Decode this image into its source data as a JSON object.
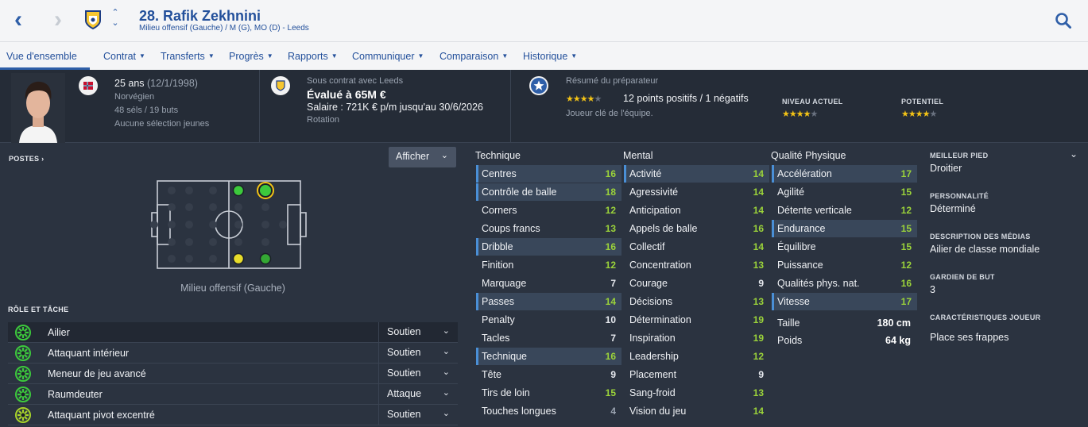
{
  "header": {
    "title": "28. Rafik Zekhnini",
    "subtitle": "Milieu offensif (Gauche) / M (G), MO (D) - Leeds"
  },
  "tabs": [
    {
      "label": "Vue d'ensemble",
      "active": true
    },
    {
      "label": "Contrat"
    },
    {
      "label": "Transferts"
    },
    {
      "label": "Progrès"
    },
    {
      "label": "Rapports"
    },
    {
      "label": "Communiquer"
    },
    {
      "label": "Comparaison"
    },
    {
      "label": "Historique"
    }
  ],
  "player": {
    "age": "25 ans",
    "birth": "(12/1/1998)",
    "nationality": "Norvégien",
    "caps": "48 séls / 19 buts",
    "youth": "Aucune sélection jeunes"
  },
  "contract": {
    "club": "Sous contrat avec Leeds",
    "value": "Évalué à 65M €",
    "salary": "Salaire : 721K € p/m jusqu'au 30/6/2026",
    "status": "Rotation"
  },
  "coach": {
    "title": "Résumé du préparateur",
    "stars": 4,
    "summary": "12 points positifs / 1 négatifs",
    "note": "Joueur clé de l'équipe.",
    "current_label": "NIVEAU ACTUEL",
    "current_stars": 4,
    "potential_label": "POTENTIEL",
    "potential_stars": 4
  },
  "positions": {
    "heading": "POSTES",
    "show_button": "Afficher",
    "label": "Milieu offensif (Gauche)"
  },
  "roles": {
    "heading": "RÔLE ET TÂCHE",
    "items": [
      {
        "name": "Ailier",
        "duty": "Soutien",
        "color": "#3cc93c"
      },
      {
        "name": "Attaquant intérieur",
        "duty": "Soutien",
        "color": "#3cc93c"
      },
      {
        "name": "Meneur de jeu avancé",
        "duty": "Soutien",
        "color": "#3cc93c"
      },
      {
        "name": "Raumdeuter",
        "duty": "Attaque",
        "color": "#3cc93c"
      },
      {
        "name": "Attaquant pivot excentré",
        "duty": "Soutien",
        "color": "#a8d42a"
      }
    ]
  },
  "attributes": {
    "technique": {
      "title": "Technique",
      "items": [
        {
          "name": "Centres",
          "value": "16",
          "hl": true
        },
        {
          "name": "Contrôle de balle",
          "value": "18",
          "hl": true
        },
        {
          "name": "Corners",
          "value": "12"
        },
        {
          "name": "Coups francs",
          "value": "13"
        },
        {
          "name": "Dribble",
          "value": "16",
          "hl": true
        },
        {
          "name": "Finition",
          "value": "12"
        },
        {
          "name": "Marquage",
          "value": "7"
        },
        {
          "name": "Passes",
          "value": "14",
          "hl": true
        },
        {
          "name": "Penalty",
          "value": "10"
        },
        {
          "name": "Tacles",
          "value": "7"
        },
        {
          "name": "Technique",
          "value": "16",
          "hl": true
        },
        {
          "name": "Tête",
          "value": "9"
        },
        {
          "name": "Tirs de loin",
          "value": "15"
        },
        {
          "name": "Touches longues",
          "value": "4"
        }
      ]
    },
    "mental": {
      "title": "Mental",
      "items": [
        {
          "name": "Activité",
          "value": "14",
          "hl": true
        },
        {
          "name": "Agressivité",
          "value": "14"
        },
        {
          "name": "Anticipation",
          "value": "14"
        },
        {
          "name": "Appels de balle",
          "value": "16"
        },
        {
          "name": "Collectif",
          "value": "14"
        },
        {
          "name": "Concentration",
          "value": "13"
        },
        {
          "name": "Courage",
          "value": "9"
        },
        {
          "name": "Décisions",
          "value": "13"
        },
        {
          "name": "Détermination",
          "value": "19"
        },
        {
          "name": "Inspiration",
          "value": "19"
        },
        {
          "name": "Leadership",
          "value": "12"
        },
        {
          "name": "Placement",
          "value": "9"
        },
        {
          "name": "Sang-froid",
          "value": "13"
        },
        {
          "name": "Vision du jeu",
          "value": "14"
        }
      ]
    },
    "physique": {
      "title": "Qualité Physique",
      "items": [
        {
          "name": "Accélération",
          "value": "17",
          "hl": true
        },
        {
          "name": "Agilité",
          "value": "15"
        },
        {
          "name": "Détente verticale",
          "value": "12"
        },
        {
          "name": "Endurance",
          "value": "15",
          "hl": true
        },
        {
          "name": "Équilibre",
          "value": "15"
        },
        {
          "name": "Puissance",
          "value": "12"
        },
        {
          "name": "Qualités phys. nat.",
          "value": "16"
        },
        {
          "name": "Vitesse",
          "value": "17",
          "hl": true
        }
      ],
      "height_label": "Taille",
      "height": "180 cm",
      "weight_label": "Poids",
      "weight": "64 kg"
    }
  },
  "info": [
    {
      "label": "MEILLEUR PIED",
      "value": "Droitier"
    },
    {
      "label": "PERSONNALITÉ",
      "value": "Déterminé"
    },
    {
      "label": "DESCRIPTION DES MÉDIAS",
      "value": "Ailier de classe mondiale"
    },
    {
      "label": "GARDIEN DE BUT",
      "value": "3"
    },
    {
      "label": "CARACTÉRISTIQUES JOUEUR",
      "value": "Place ses frappes"
    }
  ],
  "colors": {
    "accent": "#2f5fa8",
    "value_high": "#9bd33a",
    "star": "#f3c316"
  }
}
